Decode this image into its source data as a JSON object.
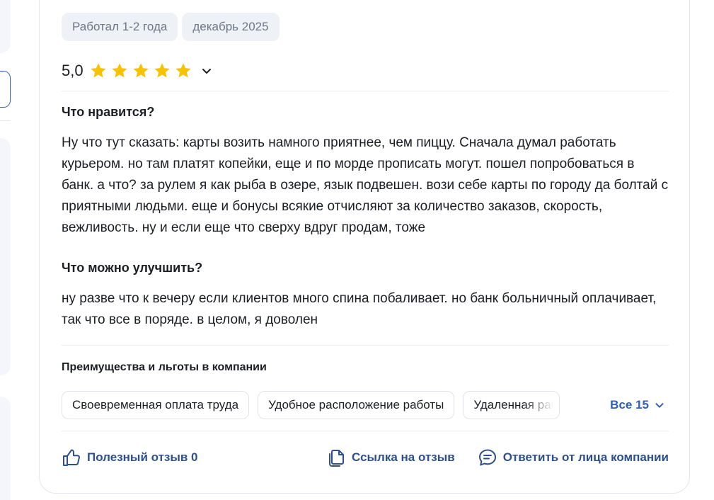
{
  "review": {
    "tags": [
      "Работал 1-2 года",
      "декабрь 2025"
    ],
    "rating": {
      "score": "5,0",
      "stars": 5,
      "max_stars": 5
    },
    "likes": {
      "title": "Что нравится?",
      "text": "Ну что тут сказать: карты возить намного приятнее, чем пиццу. Сначала думал работать курьером. но там платят копейки, еще и по морде прописать могут. пошел попробоваться в банк. а что? за рулем я как рыба в озере, язык подвешен. вози себе карты по городу да болтай с приятными людьми. еще и бонусы всякие отчисляют за количество заказов, скорость, вежливость. ну и если еще что сверху вдруг продам, тоже"
    },
    "improve": {
      "title": "Что можно улучшить?",
      "text": "ну разве что к вечеру если клиентов много спина побаливает. но банк больничный оплачивает, так что все в поряде. в целом, я доволен"
    },
    "benefits": {
      "title": "Преимущества и льготы в компании",
      "items": [
        "Своевременная оплата труда",
        "Удобное расположение работы",
        "Удаленная работа"
      ],
      "all_label": "Все 15"
    },
    "actions": {
      "useful": "Полезный отзыв 0",
      "copy_link": "Ссылка на отзыв",
      "reply": "Ответить от лица компании"
    }
  },
  "colors": {
    "star": "#f7c300",
    "link": "#2e5fbf",
    "action": "#2d4f8f",
    "tag_bg": "#eef1f6",
    "tag_text": "#6f7685"
  },
  "icons": {
    "star": "star-icon",
    "expand": "chevron-down-icon",
    "useful": "thumbs-up-icon",
    "copy_link": "copy-icon",
    "reply": "chat-bubble-icon"
  }
}
